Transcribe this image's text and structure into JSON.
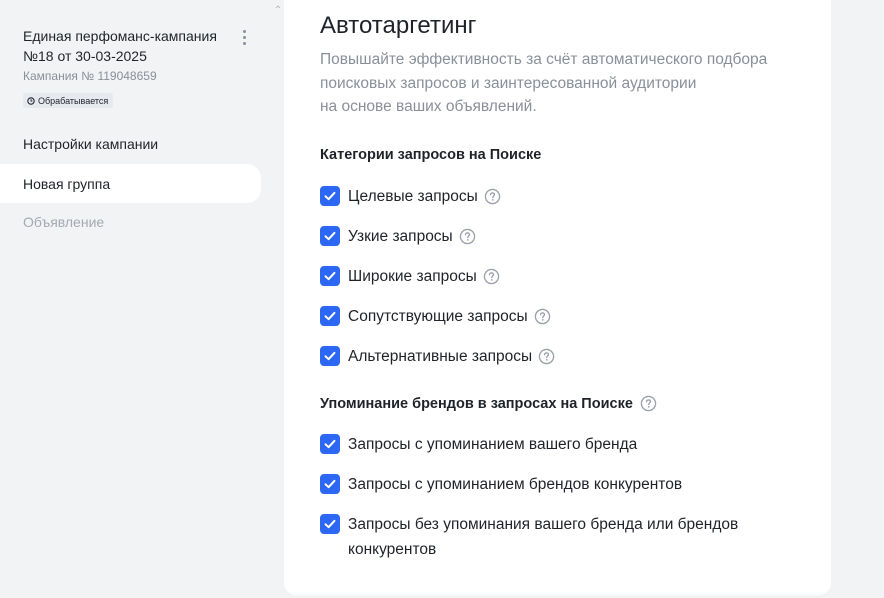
{
  "sidebar": {
    "campaign_title": "Единая перфоманс-кампания №18 от 30-03-2025",
    "campaign_number": "Кампания № 119048659",
    "status_badge": "Обрабатывается",
    "nav": [
      {
        "label": "Настройки кампании",
        "state": "normal"
      },
      {
        "label": "Новая группа",
        "state": "active"
      },
      {
        "label": "Объявление",
        "state": "disabled"
      }
    ]
  },
  "main": {
    "title": "Автотаргетинг",
    "description_lines": [
      "Повышайте эффективность за счёт автоматического подбора",
      "поисковых запросов и заинтересованной аудитории",
      "на основе ваших объявлений."
    ],
    "search_categories": {
      "title": "Категории запросов на Поиске",
      "items": [
        {
          "label": "Целевые запросы",
          "checked": true
        },
        {
          "label": "Узкие запросы",
          "checked": true
        },
        {
          "label": "Широкие запросы",
          "checked": true
        },
        {
          "label": "Сопутствующие запросы",
          "checked": true
        },
        {
          "label": "Альтернативные запросы",
          "checked": true
        }
      ]
    },
    "brand_mentions": {
      "title": "Упоминание брендов в запросах на Поиске",
      "items": [
        {
          "label": "Запросы с упоминанием вашего бренда",
          "checked": true
        },
        {
          "label": "Запросы с упоминанием брендов конкурентов",
          "checked": true
        },
        {
          "label": "Запросы без упоминания вашего бренда или брендов конкурентов",
          "checked": true
        }
      ]
    }
  },
  "colors": {
    "accent": "#2d68f5",
    "page_bg": "#f2f3f5",
    "muted_text": "#8a8f99"
  }
}
